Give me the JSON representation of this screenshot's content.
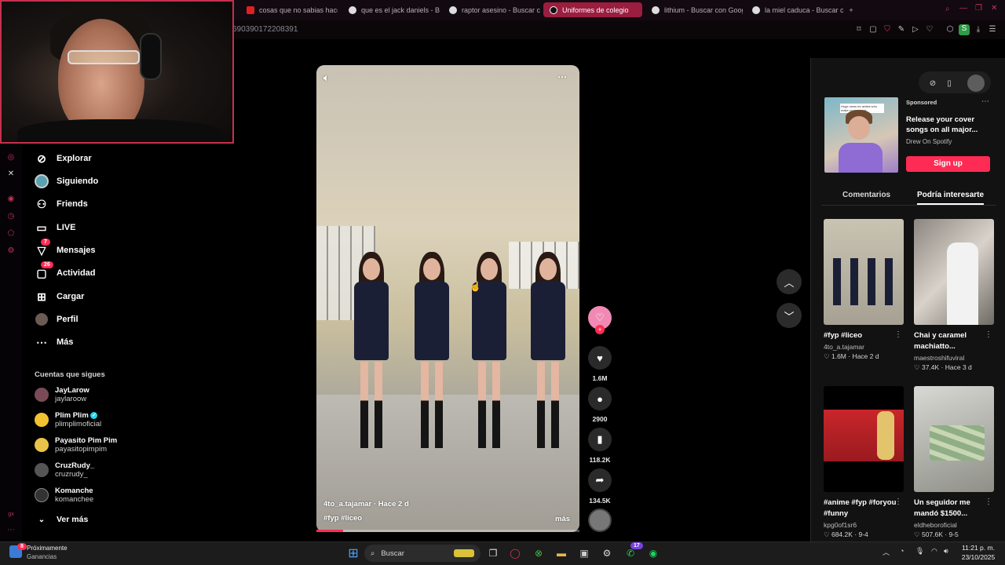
{
  "browser": {
    "tabs": [
      {
        "label": "cosas que no sabias hace",
        "icon": "youtube-icon"
      },
      {
        "label": "que es el jack daniels - B",
        "icon": "google-icon"
      },
      {
        "label": "raptor asesino - Buscar c",
        "icon": "google-icon"
      },
      {
        "label": "Uniformes de colegio",
        "icon": "tiktok-icon",
        "active": true
      },
      {
        "label": "lithium - Buscar con Goog",
        "icon": "google-icon"
      },
      {
        "label": "la miel caduca - Buscar c",
        "icon": "google-icon"
      }
    ],
    "new_tab": "+",
    "url_fragment": "690390172208391",
    "accent": "#c5304f"
  },
  "nav": {
    "items": [
      {
        "label": "Explorar",
        "icon": "compass-icon"
      },
      {
        "label": "Siguiendo",
        "icon": "following-avatar-icon"
      },
      {
        "label": "Friends",
        "icon": "friends-icon"
      },
      {
        "label": "LIVE",
        "icon": "live-icon"
      },
      {
        "label": "Mensajes",
        "icon": "messages-icon",
        "badge": "7"
      },
      {
        "label": "Actividad",
        "icon": "activity-icon",
        "badge": "26"
      },
      {
        "label": "Cargar",
        "icon": "upload-icon"
      },
      {
        "label": "Perfil",
        "icon": "profile-avatar-icon"
      },
      {
        "label": "Más",
        "icon": "more-icon"
      }
    ],
    "following_title": "Cuentas que sigues",
    "accounts": [
      {
        "name": "JayLarow",
        "handle": "jaylaroow"
      },
      {
        "name": "Plim Plim",
        "handle": "plimplimoficial",
        "verified": true
      },
      {
        "name": "Payasito Pim Pim",
        "handle": "payasitopimpim"
      },
      {
        "name": "CruzRudy_",
        "handle": "cruzrudy_"
      },
      {
        "name": "Komanche",
        "handle": "komanchee"
      }
    ],
    "see_more": "Ver más"
  },
  "video": {
    "author_line": "4to_a.tajamar · Hace 2 d",
    "hashtags": "#fyp  #liceo",
    "more": "más",
    "progress": 0.1,
    "likes": "1.6M",
    "comments": "2900",
    "saves": "118.2K",
    "shares": "134.5K"
  },
  "ad": {
    "sponsored": "Sponsored",
    "title": "Release your cover songs on all major...",
    "advertiser": "Drew On Spotify",
    "cta": "Sign up",
    "thumb_caption": "Huge news for artists who make cover songs"
  },
  "right_tabs": {
    "comments": "Comentarios",
    "recommended": "Podría interesarte"
  },
  "recommended": [
    {
      "title": "#fyp #liceo",
      "author": "4to_a.tajamar",
      "meta": "♡ 1.6M · Hace 2 d"
    },
    {
      "title": "Chai y caramel machiatto...",
      "author": "maestroshifuviral",
      "meta": "♡ 37.4K · Hace 3 d"
    },
    {
      "title": "#anime #fyp #foryou #funny",
      "author": "kpg0of1sr6",
      "meta": "♡ 684.2K · 9-4"
    },
    {
      "title": "Un seguidor me mandó $1500...",
      "author": "eldheboroficial",
      "meta": "♡ 507.6K · 9-5"
    }
  ],
  "taskbar": {
    "news_title": "Próximamente",
    "news_sub": "Ganancias",
    "news_badge": "8",
    "search_placeholder": "Buscar",
    "whatsapp_badge": "17",
    "time": "11:21 p. m.",
    "date": "23/10/2025"
  }
}
